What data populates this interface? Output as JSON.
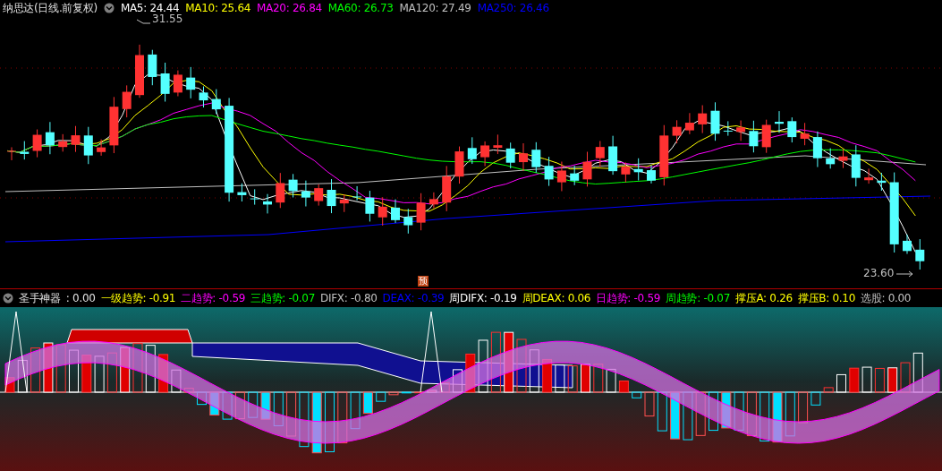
{
  "main_chart": {
    "title": "纳思达(日线.前复权)",
    "indicators": [
      {
        "text": "MA5: 24.44",
        "color": "#ffffff"
      },
      {
        "text": "MA10: 25.64",
        "color": "#ffff00"
      },
      {
        "text": "MA20: 26.84",
        "color": "#ff00ff"
      },
      {
        "text": "MA60: 26.73",
        "color": "#00ff00"
      },
      {
        "text": "MA120: 27.49",
        "color": "#c0c0c0"
      },
      {
        "text": "MA250: 26.46",
        "color": "#0000ff"
      }
    ],
    "high_label": "31.55",
    "low_label": "23.60",
    "forecast_marker": "预"
  },
  "sub_chart": {
    "title": "圣手神器",
    "value": ": 0.00",
    "indicators": [
      {
        "text": "一级趋势: -0.91",
        "color": "#ffff00"
      },
      {
        "text": "二趋势: -0.59",
        "color": "#ff00ff"
      },
      {
        "text": "三趋势: -0.07",
        "color": "#00ff00"
      },
      {
        "text": "DIFX: -0.80",
        "color": "#c0c0c0"
      },
      {
        "text": "DEAX: -0.39",
        "color": "#0000ff"
      },
      {
        "text": "周DIFX: -0.19",
        "color": "#ffffff"
      },
      {
        "text": "周DEAX: 0.06",
        "color": "#ffff00"
      },
      {
        "text": "日趋势: -0.59",
        "color": "#ff00ff"
      },
      {
        "text": "周趋势: -0.07",
        "color": "#00ff00"
      },
      {
        "text": "撑压A: 0.26",
        "color": "#ffff00"
      },
      {
        "text": "撑压B: 0.10",
        "color": "#ffff00"
      },
      {
        "text": "选股: 0.00",
        "color": "#c0c0c0"
      }
    ]
  }
}
